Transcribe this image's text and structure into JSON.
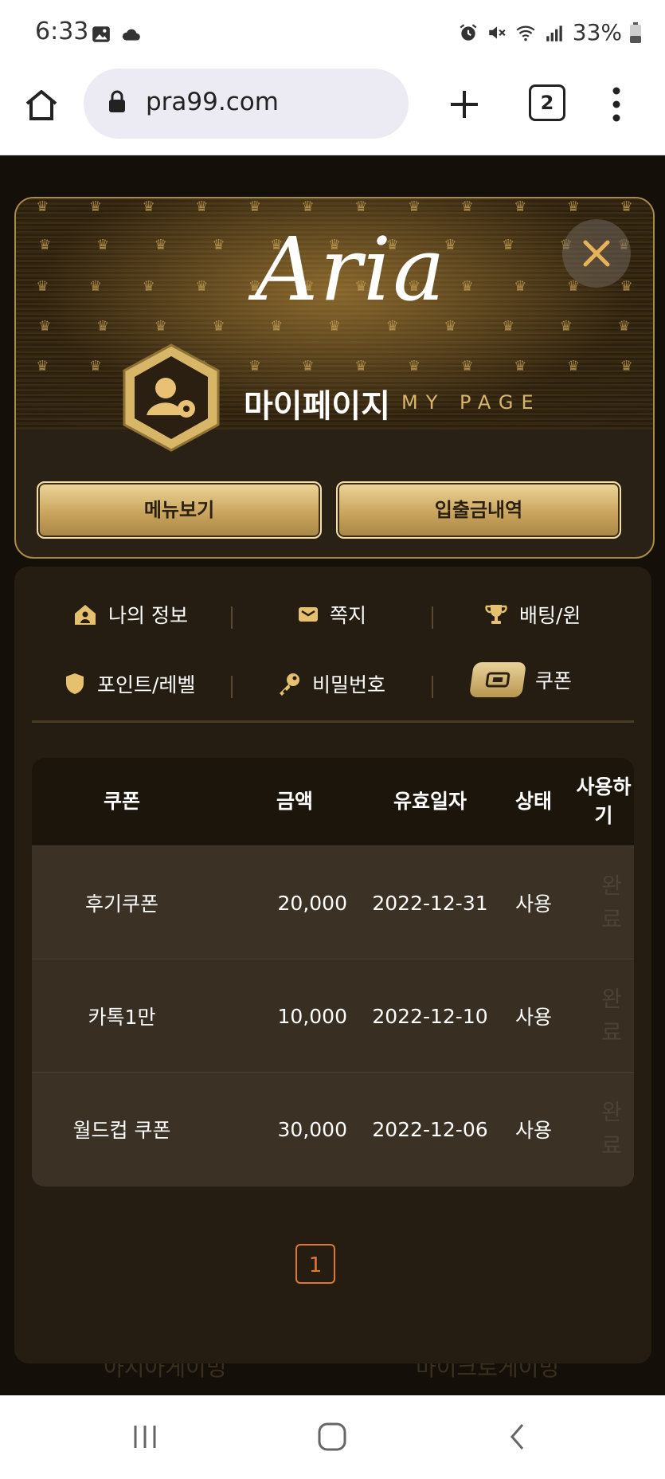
{
  "status_bar": {
    "time": "6:33",
    "battery": "33%",
    "icons": [
      "image-icon",
      "cloud-icon",
      "alarm-icon",
      "mute-icon",
      "wifi-icon",
      "signal-icon",
      "battery-icon"
    ]
  },
  "browser": {
    "url": "pra99.com",
    "tab_count": "2"
  },
  "modal": {
    "logo_text": "Aria",
    "title_ko": "마이페이지",
    "title_en": "MY PAGE",
    "buttons": {
      "menu": "메뉴보기",
      "deposit_history": "입출금내역"
    }
  },
  "nav": {
    "items": [
      {
        "label": "나의 정보",
        "icon": "home-user-icon"
      },
      {
        "label": "쪽지",
        "icon": "envelope-icon"
      },
      {
        "label": "배팅/윈",
        "icon": "trophy-icon"
      },
      {
        "label": "포인트/레벨",
        "icon": "shield-icon"
      },
      {
        "label": "비밀번호",
        "icon": "key-icon"
      },
      {
        "label": "쿠폰",
        "icon": "ticket-icon",
        "active": true
      }
    ]
  },
  "table": {
    "headers": [
      "쿠폰",
      "금액",
      "유효일자",
      "상태",
      "사용하",
      "기"
    ],
    "rows": [
      {
        "name": "후기쿠폰",
        "amount": "20,000",
        "date": "2022-12-31",
        "status": "사용",
        "action1": "완",
        "action2": "료"
      },
      {
        "name": "카톡1만",
        "amount": "10,000",
        "date": "2022-12-10",
        "status": "사용",
        "action1": "완",
        "action2": "료"
      },
      {
        "name": "월드컵 쿠폰",
        "amount": "30,000",
        "date": "2022-12-06",
        "status": "사용",
        "action1": "완",
        "action2": "료"
      }
    ]
  },
  "pagination": {
    "current": "1"
  },
  "background": {
    "left_text": "아시아게이밍",
    "right_text": "마이크로게이밍"
  },
  "colors": {
    "accent_gold": "#c9a55e",
    "page_bg": "#141009",
    "chat_blue": "#1500ee",
    "pager_orange": "#e07a2a"
  }
}
